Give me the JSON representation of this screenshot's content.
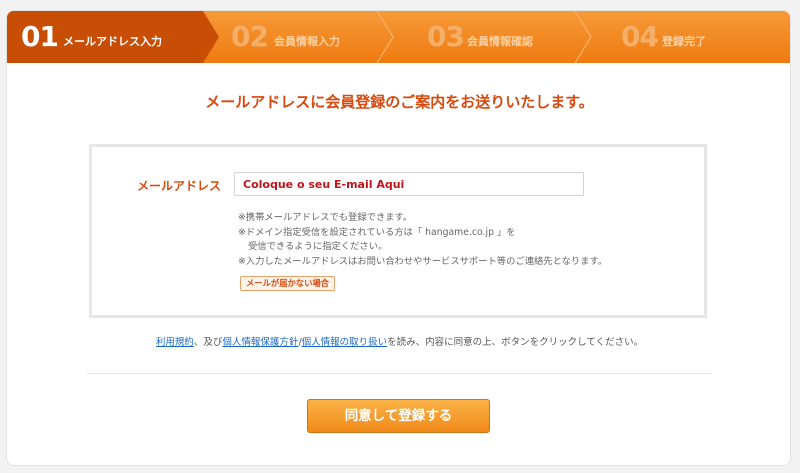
{
  "steps": [
    {
      "num": "01",
      "label": "メールアドレス入力"
    },
    {
      "num": "02",
      "label": "会員情報入力"
    },
    {
      "num": "03",
      "label": "会員情報確認"
    },
    {
      "num": "04",
      "label": "登録完了"
    }
  ],
  "headline": "メールアドレスに会員登録のご案内をお送りいたします。",
  "form": {
    "label": "メールアドレス",
    "email_placeholder": "Coloque o seu E-mail Aqui",
    "notes": [
      "※携帯メールアドレスでも登録できます。",
      "※ドメイン指定受信を設定されている方は「 hangame.co.jp 」を",
      "受信できるように指定ください。",
      "※入力したメールアドレスはお問い合わせやサービスサポート等のご連絡先となります。"
    ],
    "help_link": "メールが届かない場合"
  },
  "consent": {
    "terms": "利用規約",
    "sep1": "、及び",
    "privacy_policy": "個人情報保護方針",
    "slash": "/",
    "privacy_handling": "個人情報の取り扱い",
    "rest": "を読み、内容に同意の上、ボタンをクリックしてください。"
  },
  "submit_label": "同意して登録する",
  "colors": {
    "accent": "#ee7a10",
    "active_step": "#c84e05",
    "label": "#d9480c",
    "link": "#1a6ac5"
  }
}
